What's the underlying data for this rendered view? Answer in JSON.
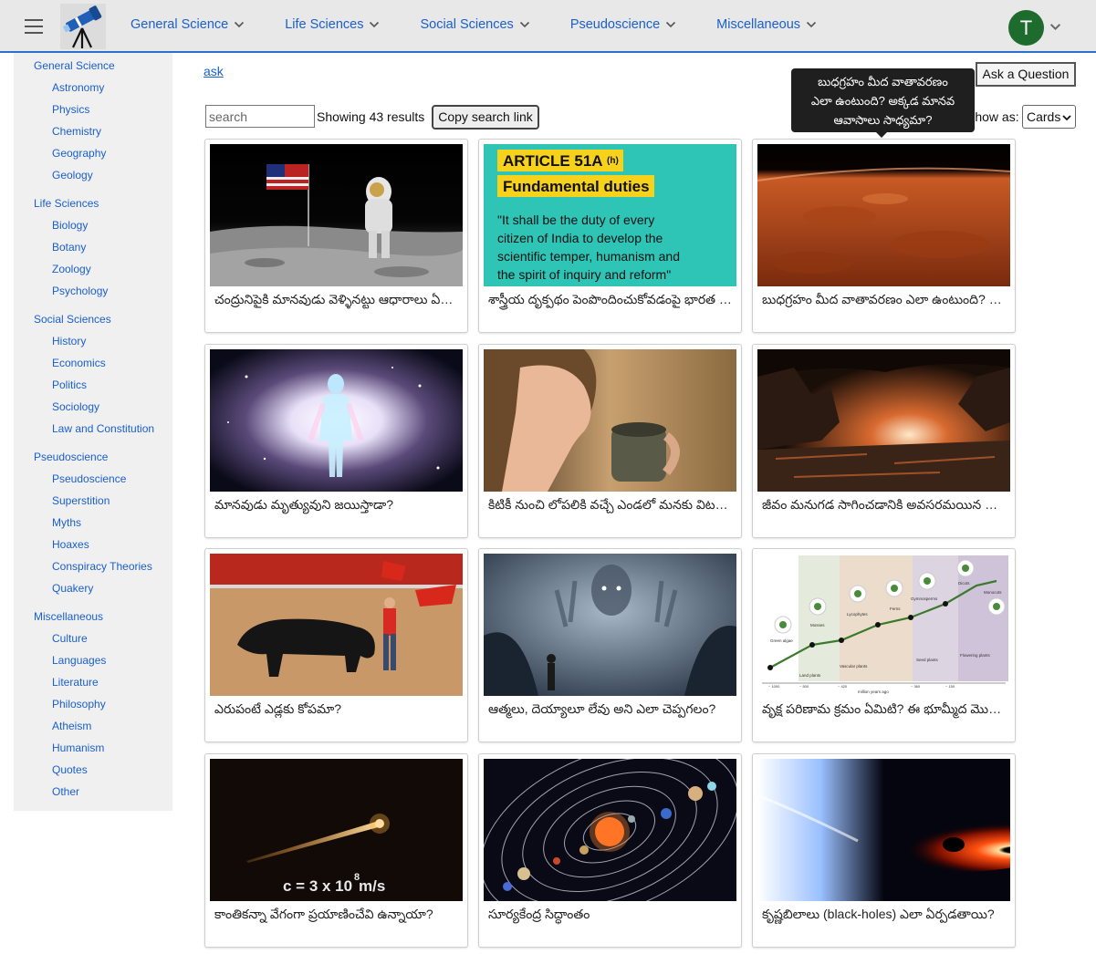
{
  "header": {
    "nav": [
      {
        "label": "General Science"
      },
      {
        "label": "Life Sciences"
      },
      {
        "label": "Social Sciences"
      },
      {
        "label": "Pseudoscience"
      },
      {
        "label": "Miscellaneous"
      }
    ],
    "avatar_letter": "T",
    "avatar_color": "#1e6b2e",
    "accent_color": "#2c6fd1"
  },
  "sidebar": {
    "groups": [
      {
        "label": "General Science",
        "items": [
          "Astronomy",
          "Physics",
          "Chemistry",
          "Geography",
          "Geology"
        ]
      },
      {
        "label": "Life Sciences",
        "items": [
          "Biology",
          "Botany",
          "Zoology",
          "Psychology"
        ]
      },
      {
        "label": "Social Sciences",
        "items": [
          "History",
          "Economics",
          "Politics",
          "Sociology",
          "Law and Constitution"
        ]
      },
      {
        "label": "Pseudoscience",
        "items": [
          "Pseudoscience",
          "Superstition",
          "Myths",
          "Hoaxes",
          "Conspiracy Theories",
          "Quakery"
        ]
      },
      {
        "label": "Miscellaneous",
        "items": [
          "Culture",
          "Languages",
          "Literature",
          "Philosophy",
          "Atheism",
          "Humanism",
          "Quotes",
          "Other"
        ]
      }
    ]
  },
  "main": {
    "ask_link": "ask",
    "ask_button": "Ask a Question",
    "search_placeholder": "search",
    "results_text": "Showing 43 results",
    "copy_button": "Copy search link",
    "show_as_label": "Show as:",
    "view_value": "Cards",
    "tooltip_lines": [
      "బుధగ్రహం మీద వాతావరణం",
      "ఎలా ఉంటుంది? అక్కడ మానవ",
      "ఆవాసాలు సాధ్యమా?"
    ]
  },
  "thumb_text": {
    "article_tag": "ARTICLE 51A",
    "article_sup": "(h)",
    "article_heading": "Fundamental duties",
    "article_quote": [
      "\"It shall be the duty of every",
      "citizen of India to develop the",
      "scientific temper, humanism and",
      "the spirit of inquiry and reform\""
    ],
    "light_formula": "c = 3 x 10",
    "light_exp": "8",
    "light_unit": " m/s",
    "evo_axis": "million years ago",
    "evo_labels": [
      "Green algae",
      "Mosses",
      "Lycophytes",
      "Ferns",
      "Gymnosperms",
      "Dicots",
      "Monocots",
      "Land plants",
      "Vascular plants",
      "Seed plants",
      "Flowering plants"
    ],
    "evo_ticks": [
      "~ 1000",
      "~ 500",
      "~ 420",
      "~ 360",
      "~ 150"
    ]
  },
  "cards": [
    {
      "title": "చంద్రునిపైకి మానవుడు వెళ్ళినట్టు ఆధారాలు ఏమిటి?",
      "icon": "moon-landing-image"
    },
    {
      "title": "శాస్త్రీయ దృక్పథం పెంపొందించుకోవడంపై భారత రాజ్యాంగం ఏమంటుంది?",
      "icon": "article-51a-image"
    },
    {
      "title": "బుధగ్రహం మీద వాతావరణం ఎలా ఉంటుంది? అక్కడ మానవ ఆవాసాలు సాధ్యమా?",
      "icon": "planet-surface-image"
    },
    {
      "title": "మానవుడు మృత్యువుని జయిస్తాడా?",
      "icon": "glowing-figure-image"
    },
    {
      "title": "కిటికీ నుంచి లోపలికి వచ్చే ఎండలో మనకు విటమిన్ డి లభిస్తుందా?",
      "icon": "woman-sunlight-image"
    },
    {
      "title": "జీవం మనుగడ సాగించడానికి అవసరమయిన పరిస్థితులు ఏమిటి?",
      "icon": "alien-landscape-image"
    },
    {
      "title": "ఎరుపంటే ఎడ్లకు కోపమా?",
      "icon": "bullfight-image"
    },
    {
      "title": "ఆత్మలు, దెయ్యాలూ లేవు అని ఎలా చెప్పగలం?",
      "icon": "ghost-image"
    },
    {
      "title": "వృక్ష పరిణామ క్రమం ఏమిటి? ఈ భూమ్మీద మొక్కలు ఎలా వచ్చాయి?",
      "icon": "plant-evolution-image"
    },
    {
      "title": "కాంతికన్నా వేగంగా ప్రయాణించేవి ఉన్నాయా?",
      "icon": "speed-of-light-image"
    },
    {
      "title": "సూర్యకేంద్ర సిద్ధాంతం",
      "icon": "solar-system-image"
    },
    {
      "title": "కృష్ణబిలాలు (black-holes) ఎలా ఏర్పడతాయి?",
      "icon": "black-hole-image"
    }
  ]
}
